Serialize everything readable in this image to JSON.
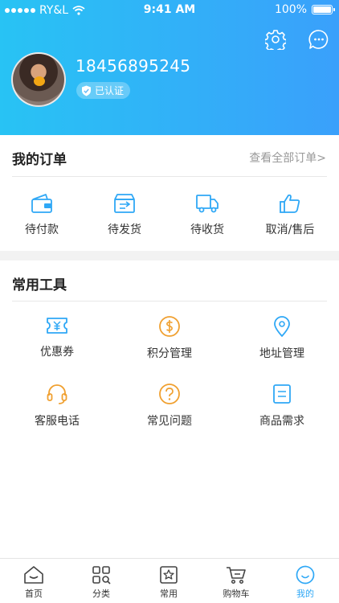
{
  "status_bar": {
    "carrier": "RY&L",
    "time": "9:41 AM",
    "battery": "100%"
  },
  "profile": {
    "phone": "18456895245",
    "verified_label": "已认证"
  },
  "orders": {
    "title": "我的订单",
    "view_all": "查看全部订单>",
    "items": [
      {
        "label": "待付款",
        "icon": "wallet-icon"
      },
      {
        "label": "待发货",
        "icon": "package-icon"
      },
      {
        "label": "待收货",
        "icon": "truck-icon"
      },
      {
        "label": "取消/售后",
        "icon": "thumbs-up-icon"
      }
    ]
  },
  "tools": {
    "title": "常用工具",
    "items": [
      {
        "label": "优惠券",
        "icon": "coupon-icon"
      },
      {
        "label": "积分管理",
        "icon": "dollar-coin-icon"
      },
      {
        "label": "地址管理",
        "icon": "location-pin-icon"
      },
      {
        "label": "客服电话",
        "icon": "headset-icon"
      },
      {
        "label": "常见问题",
        "icon": "question-icon"
      },
      {
        "label": "商品需求",
        "icon": "document-icon"
      }
    ]
  },
  "tabbar": {
    "items": [
      {
        "label": "首页",
        "icon": "home-icon"
      },
      {
        "label": "分类",
        "icon": "category-icon"
      },
      {
        "label": "常用",
        "icon": "star-box-icon"
      },
      {
        "label": "购物车",
        "icon": "cart-icon"
      },
      {
        "label": "我的",
        "icon": "smile-icon",
        "active": true
      }
    ]
  },
  "colors": {
    "header_start": "#28c3f4",
    "header_end": "#3aa0fb",
    "order_icon": "#2fa8f6",
    "tool_blue": "#2fa8f6",
    "tool_orange": "#f0a030",
    "tab_active": "#2fa8f6"
  }
}
